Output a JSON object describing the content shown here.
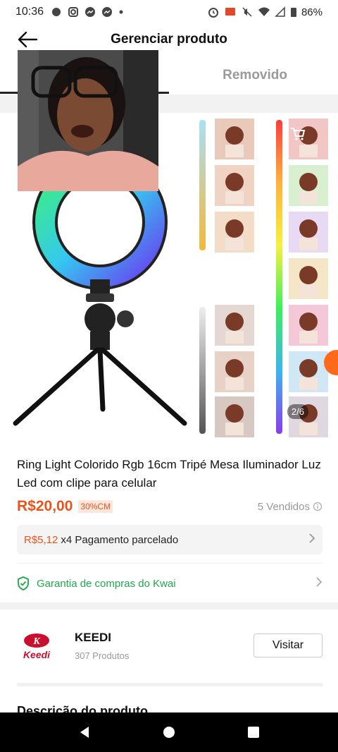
{
  "status_bar": {
    "time": "10:36",
    "battery": "86%"
  },
  "header": {
    "title": "Gerenciar produto"
  },
  "tabs": {
    "removed_label": "Removido"
  },
  "product": {
    "image_counter": "2/6",
    "title": "Ring Light Colorido Rgb 16cm Tripé Mesa Iluminador Luz Led com clipe para celular",
    "price": "R$20,00",
    "discount": "30%CM",
    "sold": "5 Vendidos",
    "installment_amount": "R$5,12",
    "installment_text": "x4 Pagamento parcelado",
    "guarantee": "Garantia de compras do Kwai"
  },
  "shop": {
    "logo_text": "Keedi",
    "name": "KEEDI",
    "products": "307 Produtos",
    "visit_label": "Visitar"
  },
  "description_title": "Descrição do produto",
  "colors": {
    "accent": "#e8551c",
    "guarantee_green": "#1fa84a"
  },
  "icons": {
    "back": "arrow-left-icon",
    "cart": "cart-icon",
    "info": "info-circle-icon",
    "shield": "shield-check-icon",
    "chevron": "chevron-right-icon",
    "nav_back": "triangle-back-icon",
    "nav_home": "circle-home-icon",
    "nav_recents": "square-recents-icon"
  }
}
